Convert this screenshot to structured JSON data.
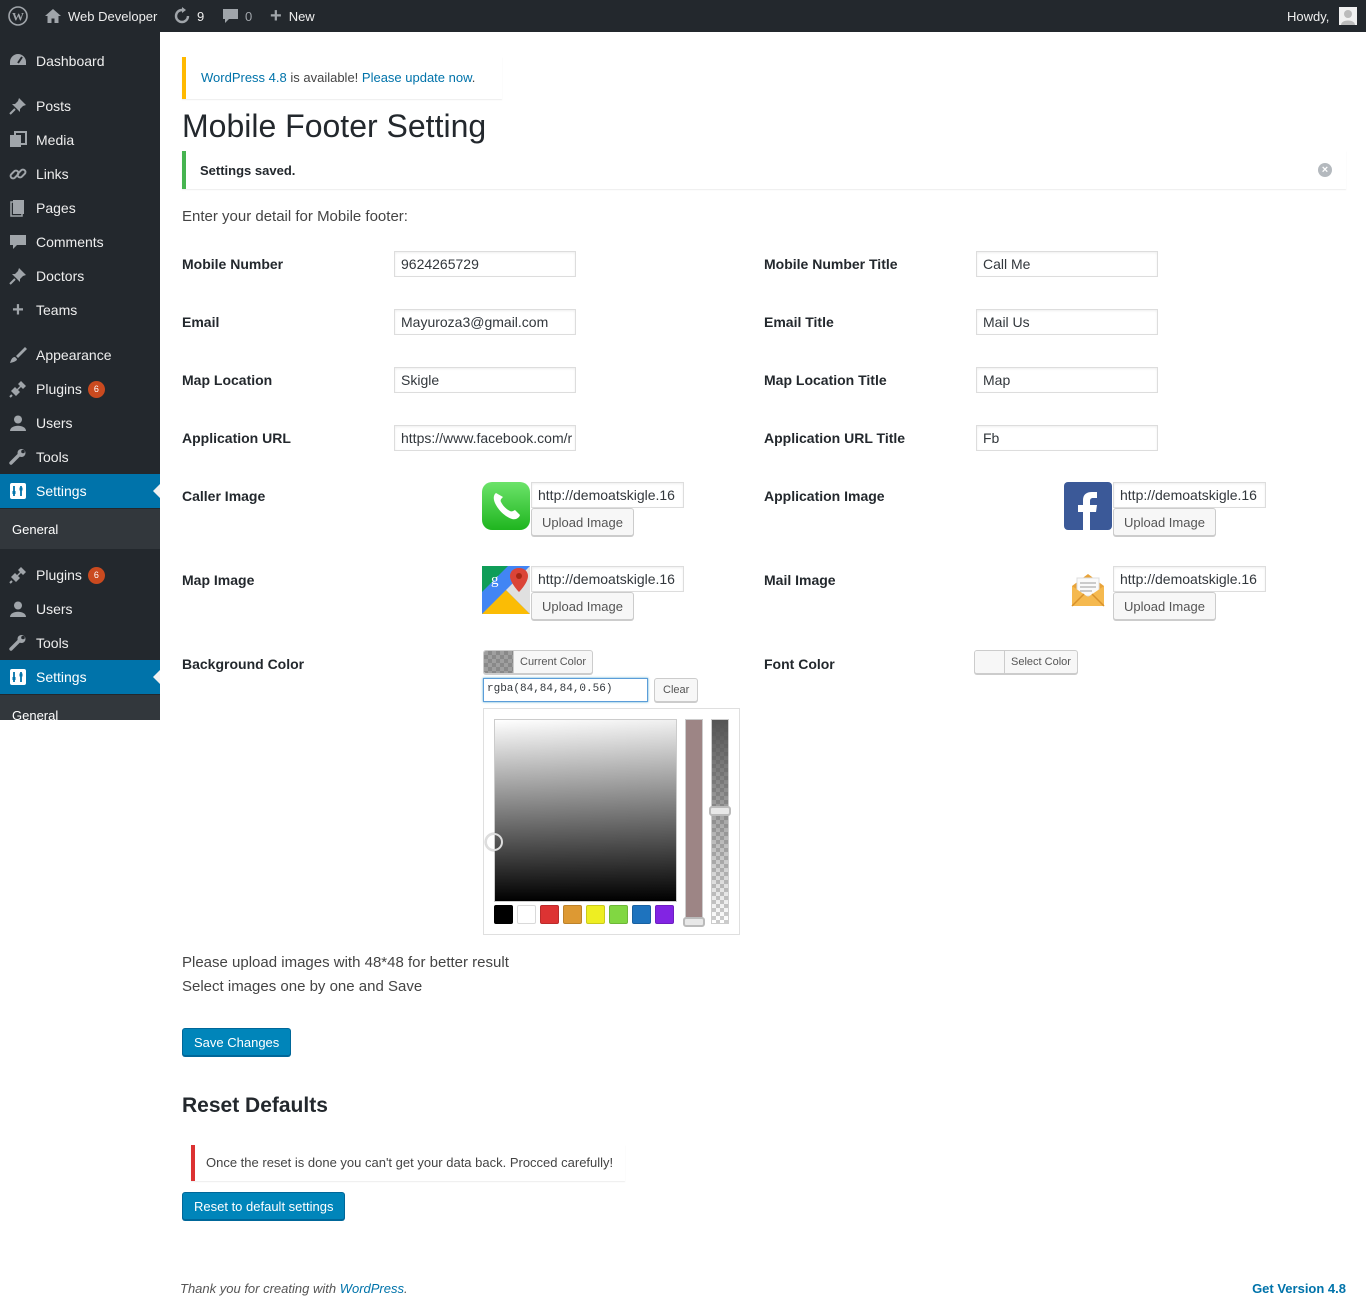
{
  "adminbar": {
    "site_name": "Web Developer",
    "updates_count": "9",
    "comments_count": "0",
    "new_label": "New",
    "howdy": "Howdy,"
  },
  "sidebar": {
    "items": [
      {
        "label": "Dashboard",
        "icon": "dashboard-icon"
      },
      {
        "label": "Posts",
        "icon": "pin-icon"
      },
      {
        "label": "Media",
        "icon": "media-icon"
      },
      {
        "label": "Links",
        "icon": "link-icon"
      },
      {
        "label": "Pages",
        "icon": "pages-icon"
      },
      {
        "label": "Comments",
        "icon": "comment-icon"
      },
      {
        "label": "Doctors",
        "icon": "pin-icon"
      },
      {
        "label": "Teams",
        "icon": "plus-icon"
      },
      {
        "label": "Appearance",
        "icon": "brush-icon"
      },
      {
        "label": "Plugins",
        "icon": "plugin-icon",
        "badge": "6"
      },
      {
        "label": "Users",
        "icon": "user-icon"
      },
      {
        "label": "Tools",
        "icon": "wrench-icon"
      },
      {
        "label": "Settings",
        "icon": "settings-icon"
      },
      {
        "label": "General"
      },
      {
        "label": "Plugins",
        "icon": "plugin-icon",
        "badge": "6"
      },
      {
        "label": "Users",
        "icon": "user-icon"
      },
      {
        "label": "Tools",
        "icon": "wrench-icon"
      },
      {
        "label": "Settings",
        "icon": "settings-icon"
      },
      {
        "label": "General"
      }
    ]
  },
  "update_notice": {
    "version_link": "WordPress 4.8",
    "middle": " is available! ",
    "update_link": "Please update now",
    "end": "."
  },
  "page_title": "Mobile Footer Setting",
  "saved_notice": "Settings saved.",
  "intro": "Enter your detail for Mobile footer:",
  "fields": {
    "mobile_number": {
      "label": "Mobile Number",
      "value": "9624265729"
    },
    "mobile_number_title": {
      "label": "Mobile Number Title",
      "value": "Call Me"
    },
    "email": {
      "label": "Email",
      "value": "Mayuroza3@gmail.com"
    },
    "email_title": {
      "label": "Email Title",
      "value": "Mail Us"
    },
    "map_location": {
      "label": "Map Location",
      "value": "Skigle"
    },
    "map_location_title": {
      "label": "Map Location Title",
      "value": "Map"
    },
    "application_url": {
      "label": "Application URL",
      "value": "https://www.facebook.com/r"
    },
    "application_url_title": {
      "label": "Application URL Title",
      "value": "Fb"
    }
  },
  "images": {
    "caller": {
      "label": "Caller Image",
      "url": "http://demoatskigle.16",
      "button": "Upload Image"
    },
    "application": {
      "label": "Application Image",
      "url": "http://demoatskigle.16",
      "button": "Upload Image"
    },
    "map": {
      "label": "Map Image",
      "url": "http://demoatskigle.16",
      "button": "Upload Image"
    },
    "mail": {
      "label": "Mail Image",
      "url": "http://demoatskigle.16",
      "button": "Upload Image"
    }
  },
  "colors": {
    "background": {
      "label": "Background Color",
      "button": "Current Color",
      "value": "rgba(84,84,84,0.56)",
      "clear": "Clear"
    },
    "font": {
      "label": "Font Color",
      "button": "Select Color"
    },
    "palette": [
      "#000000",
      "#ffffff",
      "#dd3333",
      "#dd9933",
      "#eeee22",
      "#81d742",
      "#1e73be",
      "#8224e3"
    ],
    "alpha": 0.56
  },
  "help": {
    "line1": "Please upload images with 48*48 for better result",
    "line2": "Select images one by one and Save"
  },
  "save_button": "Save Changes",
  "reset": {
    "title": "Reset Defaults",
    "warning": "Once the reset is done you can't get your data back. Procced carefully!",
    "button": "Reset to default settings"
  },
  "footer": {
    "thanks": "Thank you for creating with ",
    "wp_link": "WordPress",
    "period": ".",
    "version": "Get Version 4.8"
  }
}
